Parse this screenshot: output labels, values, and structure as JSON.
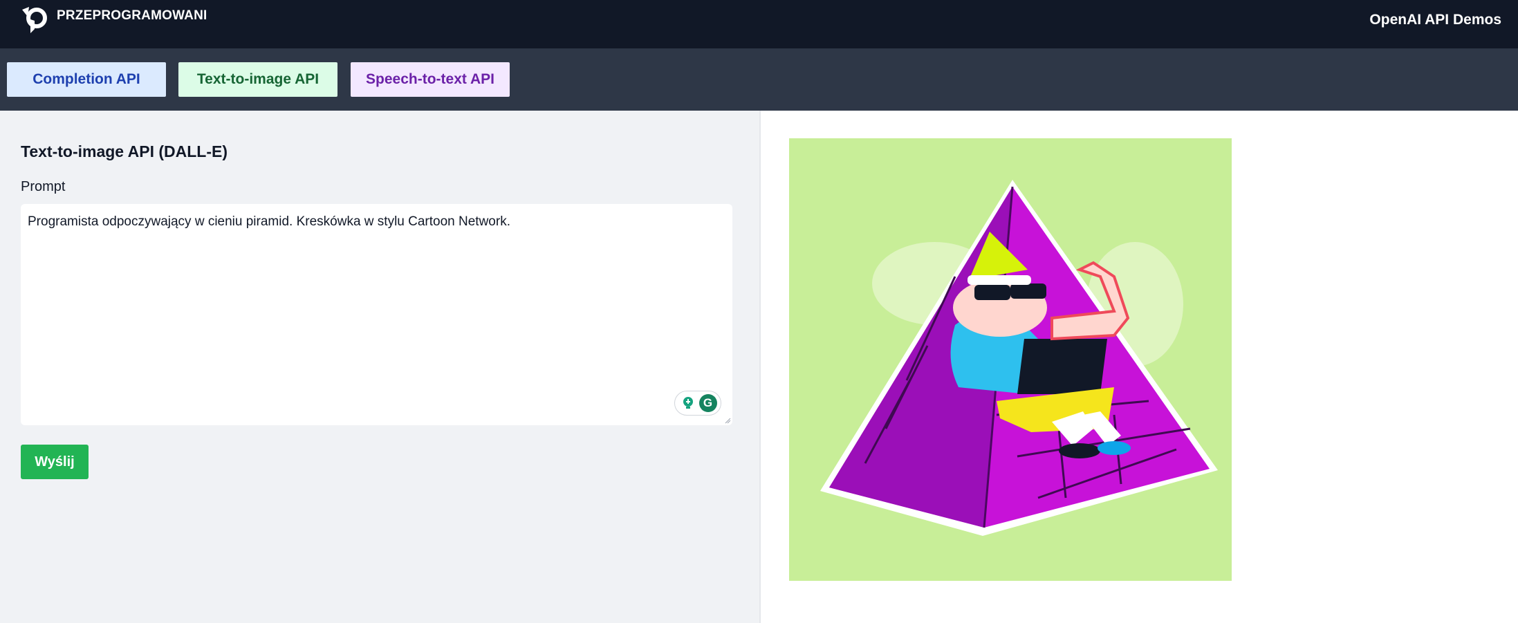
{
  "header": {
    "brand": "PRZEPROGRAMOWANI",
    "logo_icon": "przeprogramowani-logo",
    "title": "OpenAI API Demos"
  },
  "tabs": [
    {
      "label": "Completion API",
      "color": "#1e40af",
      "bg": "#dbeafe"
    },
    {
      "label": "Text-to-image API",
      "color": "#166534",
      "bg": "#dcfce7"
    },
    {
      "label": "Speech-to-text API",
      "color": "#6b21a8",
      "bg": "#f3e8ff"
    }
  ],
  "form": {
    "title": "Text-to-image API (DALL-E)",
    "prompt_label": "Prompt",
    "prompt_value": "Programista odpoczywający w cieniu piramid. Kreskówka w stylu Cartoon Network.",
    "submit_label": "Wyślij",
    "submit_color": "#22b454"
  },
  "result": {
    "image_icon": "generated-image",
    "image_bg": "#c8ee98"
  }
}
